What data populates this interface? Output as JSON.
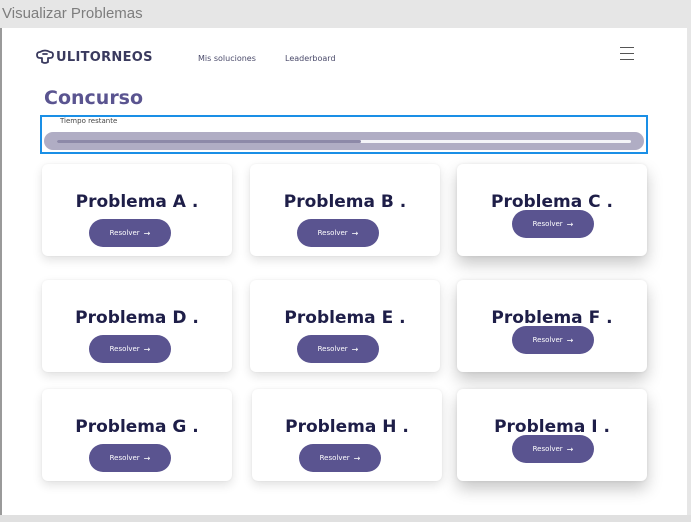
{
  "window": {
    "title": "Visualizar Problemas"
  },
  "navbar": {
    "logo_text": "ULITORNEOS",
    "links": [
      "Mis soluciones",
      "Leaderboard"
    ]
  },
  "contest": {
    "heading": "Concurso",
    "timer_label": "Tiempo restante",
    "time_remaining_fraction": 0.53
  },
  "problems": [
    {
      "title": "Problema A .",
      "button": "Resolver"
    },
    {
      "title": "Problema B .",
      "button": "Resolver"
    },
    {
      "title": "Problema C .",
      "button": "Resolver"
    },
    {
      "title": "Problema D .",
      "button": "Resolver"
    },
    {
      "title": "Problema E .",
      "button": "Resolver"
    },
    {
      "title": "Problema F .",
      "button": "Resolver"
    },
    {
      "title": "Problema G .",
      "button": "Resolver"
    },
    {
      "title": "Problema H .",
      "button": "Resolver"
    },
    {
      "title": "Problema I .",
      "button": "Resolver"
    }
  ],
  "colors": {
    "accent": "#5a5490",
    "title_text": "#1e1e48",
    "timer_border": "#1a8fe6"
  }
}
